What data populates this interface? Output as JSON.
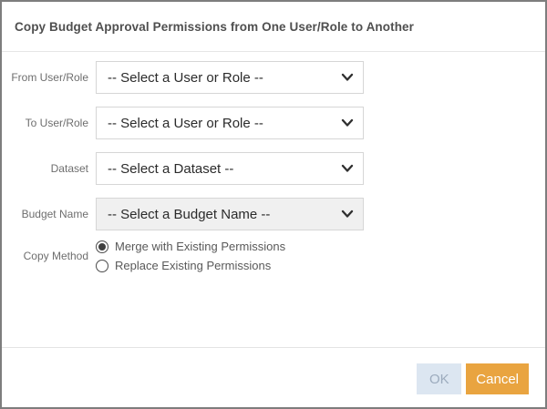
{
  "dialog": {
    "title": "Copy Budget Approval Permissions from One User/Role to Another"
  },
  "form": {
    "fields": [
      {
        "label": "From User/Role",
        "value": "-- Select a User or Role --",
        "disabled": false
      },
      {
        "label": "To User/Role",
        "value": "-- Select a User or Role --",
        "disabled": false
      },
      {
        "label": "Dataset",
        "value": "-- Select a Dataset --",
        "disabled": false
      },
      {
        "label": "Budget Name",
        "value": "-- Select a Budget Name --",
        "disabled": true
      }
    ],
    "copy_method": {
      "label": "Copy Method",
      "options": [
        {
          "label": "Merge with Existing Permissions",
          "selected": true
        },
        {
          "label": "Replace Existing Permissions",
          "selected": false
        }
      ]
    }
  },
  "footer": {
    "ok_label": "OK",
    "cancel_label": "Cancel"
  },
  "colors": {
    "ok_disabled_bg": "#dce6f1",
    "ok_disabled_fg": "#9cabbd",
    "cancel_bg": "#e9a440",
    "cancel_fg": "#ffffff",
    "dialog_border": "#7d7d7d"
  }
}
